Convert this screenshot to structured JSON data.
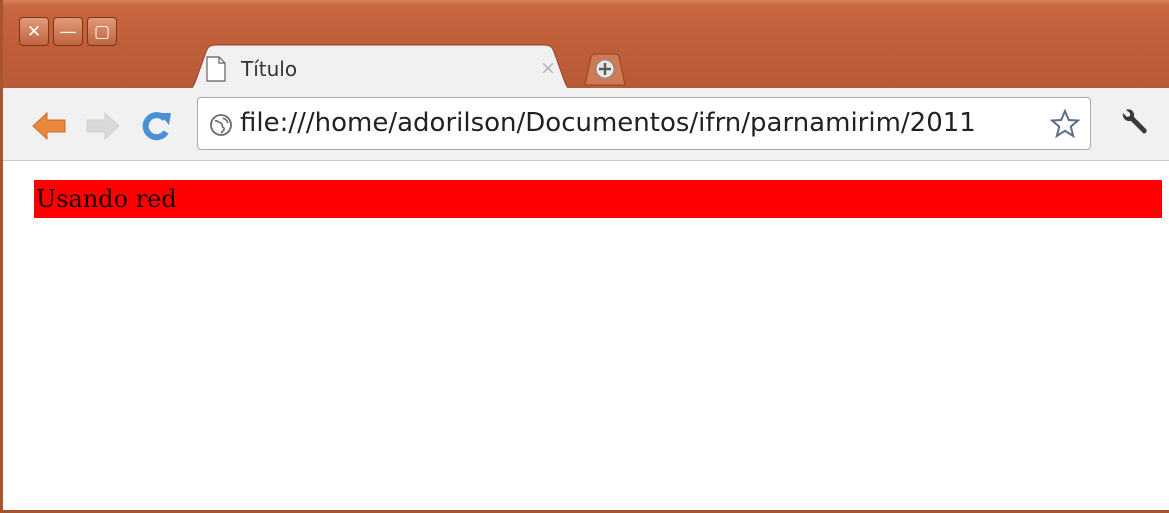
{
  "window": {
    "close_glyph": "✕",
    "minimize_glyph": "—",
    "maximize_glyph": "▢"
  },
  "tab": {
    "title": "Título",
    "close_glyph": "×",
    "icon": "page-icon"
  },
  "toolbar": {
    "url": "file:///home/adorilson/Documentos/ifrn/parnamirim/2011",
    "back_icon": "back-arrow-icon",
    "forward_icon": "forward-arrow-icon",
    "reload_icon": "reload-icon",
    "bookmark_icon": "star-icon",
    "menu_icon": "wrench-icon"
  },
  "page": {
    "text": "Usando red",
    "background": "#ff0000"
  },
  "colors": {
    "titlebar": "#c0603a",
    "back_arrow": "#e9883d"
  }
}
